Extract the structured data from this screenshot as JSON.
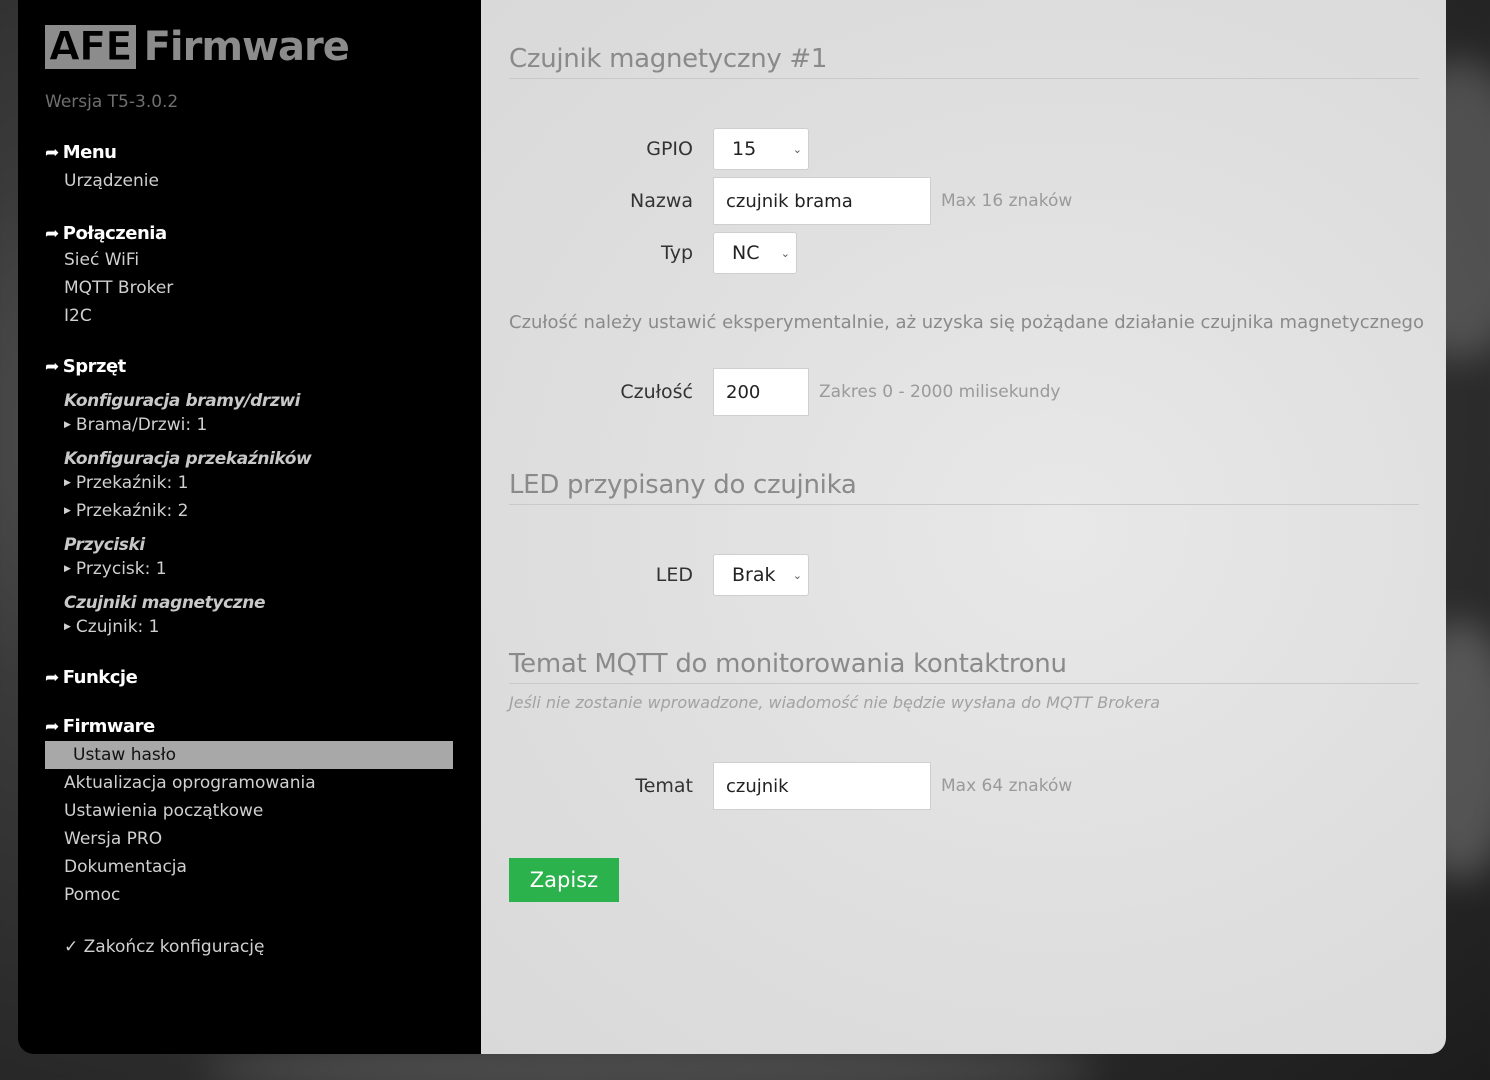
{
  "sidebar": {
    "logo_box": "AFE",
    "logo_text": "Firmware",
    "version": "Wersja T5-3.0.2",
    "arrow_glyph": "➦",
    "sections": {
      "menu": {
        "title": "Menu",
        "items": [
          "Urządzenie"
        ]
      },
      "connections": {
        "title": "Połączenia",
        "items": [
          "Sieć WiFi",
          "MQTT Broker",
          "I2C"
        ]
      },
      "hardware": {
        "title": "Sprzęt",
        "groups": [
          {
            "title": "Konfiguracja bramy/drzwi",
            "items": [
              "Brama/Drzwi: 1"
            ]
          },
          {
            "title": "Konfiguracja przekaźników",
            "items": [
              "Przekaźnik: 1",
              "Przekaźnik: 2"
            ]
          },
          {
            "title": "Przyciski",
            "items": [
              "Przycisk: 1"
            ]
          },
          {
            "title": "Czujniki magnetyczne",
            "items": [
              "Czujnik: 1"
            ]
          }
        ]
      },
      "functions": {
        "title": "Funkcje"
      },
      "firmware": {
        "title": "Firmware",
        "active_item": "Ustaw hasło",
        "items": [
          "Aktualizacja oprogramowania",
          "Ustawienia początkowe",
          "Wersja PRO",
          "Dokumentacja",
          "Pomoc"
        ]
      }
    },
    "finish": "✓ Zakończ konfigurację"
  },
  "main": {
    "section1_title": "Czujnik magnetyczny #1",
    "gpio": {
      "label": "GPIO",
      "value": "15"
    },
    "name": {
      "label": "Nazwa",
      "value": "czujnik brama",
      "hint": "Max 16 znaków"
    },
    "type": {
      "label": "Typ",
      "value": "NC"
    },
    "sensitivity_note": "Czułość należy ustawić eksperymentalnie, aż uzyska się pożądane działanie czujnika magnetycznego",
    "sensitivity": {
      "label": "Czułość",
      "value": "200",
      "hint": "Zakres 0 - 2000 milisekundy"
    },
    "section2_title": "LED przypisany do czujnika",
    "led": {
      "label": "LED",
      "value": "Brak"
    },
    "section3_title": "Temat MQTT do monitorowania kontaktronu",
    "section3_note": "Jeśli nie zostanie wprowadzone, wiadomość nie będzie wysłana do MQTT Brokera",
    "topic": {
      "label": "Temat",
      "value": "czujnik",
      "hint": "Max 64 znaków"
    },
    "save_label": "Zapisz"
  },
  "colors": {
    "accent": "#2bb24c",
    "sidebar_bg": "#000000",
    "active_bg": "#a8a8a8"
  }
}
